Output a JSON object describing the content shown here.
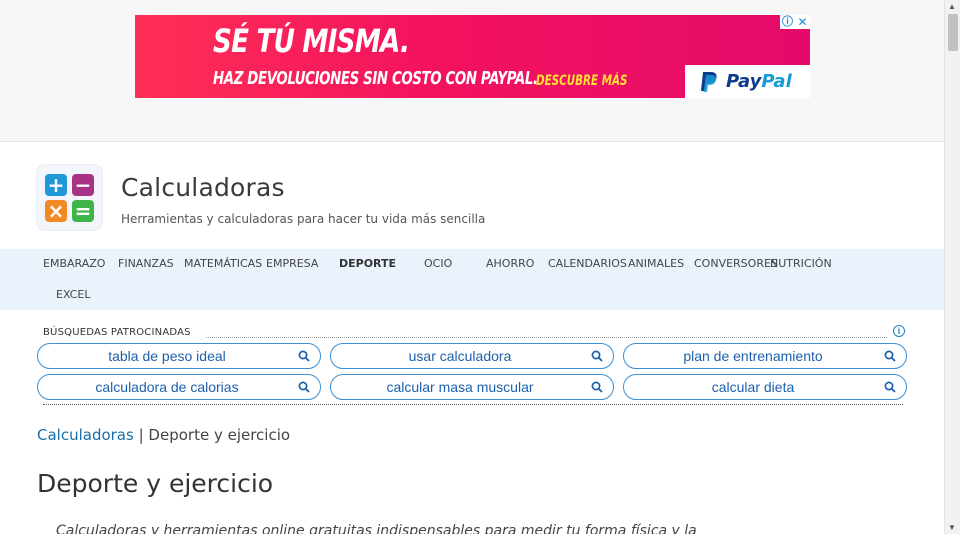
{
  "ad": {
    "headline": "SÉ TÚ MISMA.",
    "subline": "HAZ DEVOLUCIONES SIN COSTO CON PAYPAL.",
    "cta": "DESCUBRE MÁS",
    "brand_a": "Pay",
    "brand_b": "Pal",
    "info_symbol": "ⓘ",
    "close_symbol": "✕"
  },
  "header": {
    "title": "Calculadoras",
    "tagline": "Herramientas y calculadoras para hacer tu vida más sencilla",
    "logo_icons": [
      "plus-icon",
      "minus-icon",
      "times-icon",
      "equals-icon"
    ]
  },
  "nav": {
    "items": [
      {
        "label": "EMBARAZO"
      },
      {
        "label": "FINANZAS"
      },
      {
        "label": "MATEMÁTICAS"
      },
      {
        "label": "EMPRESA"
      },
      {
        "label": "DEPORTE",
        "active": true
      },
      {
        "label": "OCIO"
      },
      {
        "label": "AHORRO"
      },
      {
        "label": "CALENDARIOS"
      },
      {
        "label": "ANIMALES"
      },
      {
        "label": "CONVERSORES"
      },
      {
        "label": "NUTRICIÓN"
      },
      {
        "label": "EXCEL"
      }
    ]
  },
  "sponsored": {
    "label": "BÚSQUEDAS PATROCINADAS",
    "info_symbol": "ⓘ",
    "searches": [
      "tabla de peso ideal",
      "usar calculadora",
      "plan de entrenamiento",
      "calculadora de calorias",
      "calcular masa muscular",
      "calcular dieta"
    ]
  },
  "breadcrumb": {
    "home": "Calculadoras",
    "separator": " | ",
    "current": "Deporte y ejercicio"
  },
  "page": {
    "title": "Deporte y ejercicio",
    "intro": "Calculadoras y herramientas online gratuitas indispensables para medir tu forma física y la"
  },
  "colors": {
    "accent": "#3a8fd6",
    "link": "#1a6fa8",
    "nav_bg": "#eaf3fb",
    "ad_bg": "#f3125f",
    "ad_cta": "#ffe033"
  }
}
